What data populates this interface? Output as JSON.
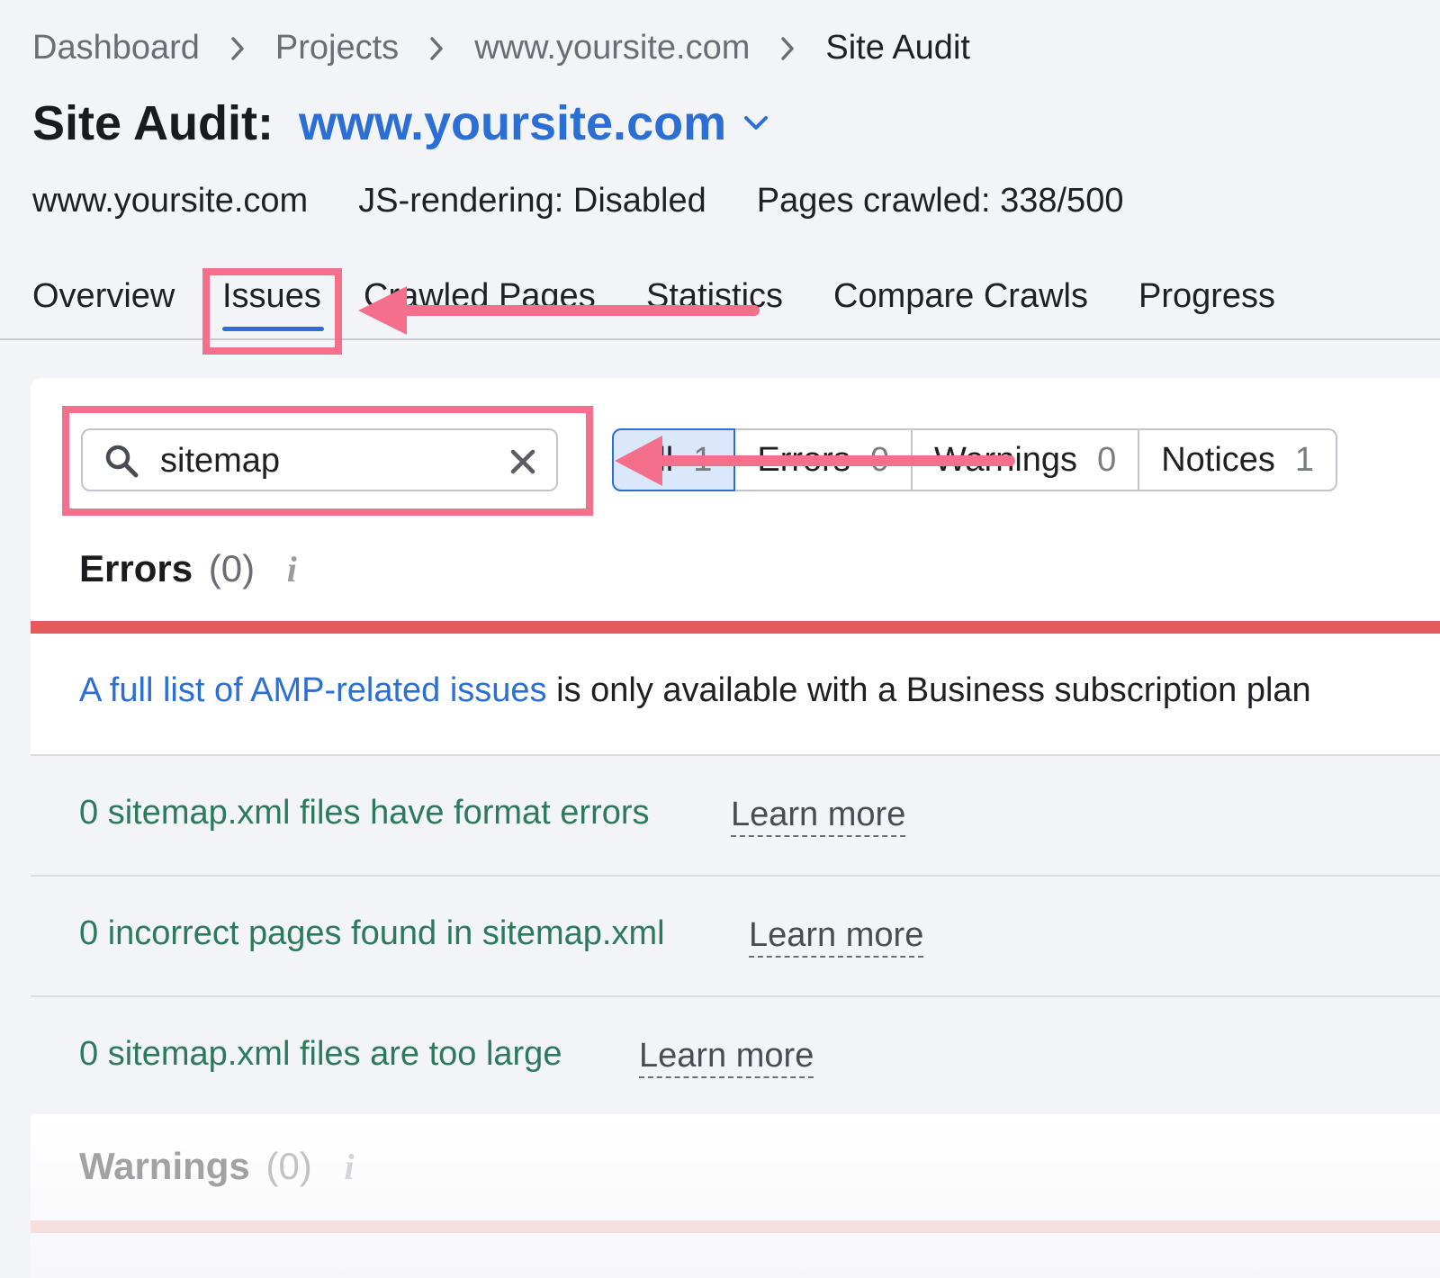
{
  "breadcrumb": {
    "items": [
      "Dashboard",
      "Projects",
      "www.yoursite.com"
    ],
    "current": "Site Audit"
  },
  "title": {
    "prefix": "Site Audit:",
    "domain": "www.yoursite.com"
  },
  "meta": {
    "site": "www.yoursite.com",
    "js_rendering": "JS-rendering: Disabled",
    "pages_crawled": "Pages crawled: 338/500"
  },
  "tabs": [
    {
      "label": "Overview"
    },
    {
      "label": "Issues",
      "active": true
    },
    {
      "label": "Crawled Pages"
    },
    {
      "label": "Statistics"
    },
    {
      "label": "Compare Crawls"
    },
    {
      "label": "Progress"
    }
  ],
  "search": {
    "value": "sitemap",
    "placeholder": ""
  },
  "filters": [
    {
      "label": "All",
      "count": "1",
      "active": true
    },
    {
      "label": "Errors",
      "count": "0"
    },
    {
      "label": "Warnings",
      "count": "0"
    },
    {
      "label": "Notices",
      "count": "1"
    }
  ],
  "errors_section": {
    "title": "Errors",
    "count": "(0)",
    "info_icon": "i"
  },
  "notice": {
    "link": "A full list of AMP-related issues",
    "text": " is only available with a Business subscription plan"
  },
  "issues": [
    {
      "text": "0 sitemap.xml files have format errors",
      "learn_more": "Learn more"
    },
    {
      "text": "0 incorrect pages found in sitemap.xml",
      "learn_more": "Learn more"
    },
    {
      "text": "0 sitemap.xml files are too large",
      "learn_more": "Learn more"
    }
  ],
  "warnings_section": {
    "title": "Warnings",
    "count": "(0)",
    "info_icon": "i"
  },
  "colors": {
    "accent": "#2b6fd6",
    "error": "#e45b5b",
    "issue_text": "#2c7a5c",
    "annotation": "#f46f8c",
    "background": "#f3f4f8"
  },
  "icons": [
    "chevron-right-icon",
    "chevron-down-icon",
    "search-icon",
    "close-icon",
    "info-icon"
  ]
}
